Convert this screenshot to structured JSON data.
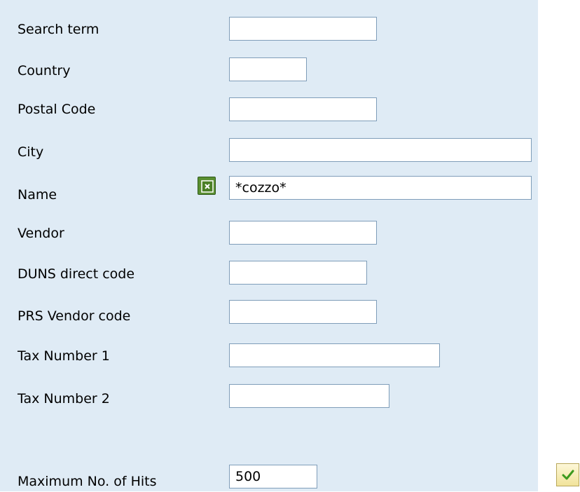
{
  "form": {
    "fields": {
      "search_term": {
        "label": "Search term",
        "value": ""
      },
      "country": {
        "label": "Country",
        "value": ""
      },
      "postal_code": {
        "label": "Postal Code",
        "value": ""
      },
      "city": {
        "label": "City",
        "value": ""
      },
      "name": {
        "label": "Name",
        "value": "*cozzo*"
      },
      "vendor": {
        "label": "Vendor",
        "value": ""
      },
      "duns": {
        "label": "DUNS direct code",
        "value": ""
      },
      "prs_vendor": {
        "label": "PRS Vendor code",
        "value": ""
      },
      "tax1": {
        "label": "Tax Number 1",
        "value": ""
      },
      "tax2": {
        "label": "Tax Number 2",
        "value": ""
      },
      "max_hits": {
        "label": "Maximum No. of Hits",
        "value": "500"
      }
    }
  },
  "icons": {
    "name_option": "exclude-selection-icon",
    "confirm": "checkmark-icon"
  },
  "colors": {
    "panel_background": "#dfebf5",
    "field_border": "#7f9db9",
    "option_button": "#5a8f31",
    "confirm_check": "#3c9a1e"
  }
}
